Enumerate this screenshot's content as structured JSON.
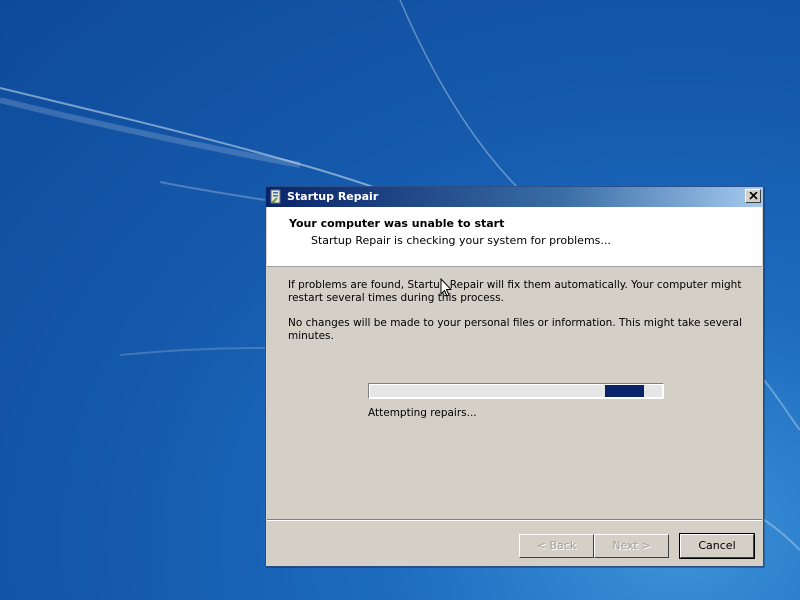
{
  "dialog": {
    "title": "Startup Repair",
    "header_title": "Your computer was unable to start",
    "header_subtitle": "Startup Repair is checking your system for problems...",
    "paragraph1": "If problems are found, Startup Repair will fix them automatically. Your computer might restart several times during this process.",
    "paragraph2": "No changes will be made to your personal files or information. This might take several minutes.",
    "status_text": "Attempting repairs...",
    "progress": {
      "type": "marquee",
      "segment_start_fraction": 0.805,
      "segment_fraction": 0.135
    },
    "buttons": {
      "back_label": "< Back",
      "next_label": "Next >",
      "cancel_label": "Cancel"
    }
  },
  "icons": {
    "title": "startup-repair-icon",
    "close": "close-icon",
    "cursor": "mouse-pointer-icon"
  },
  "colors": {
    "desktop": "#1559ab",
    "titlebar_start": "#0a246a",
    "titlebar_end": "#a6caf0",
    "progress_fill": "#0a246a"
  }
}
